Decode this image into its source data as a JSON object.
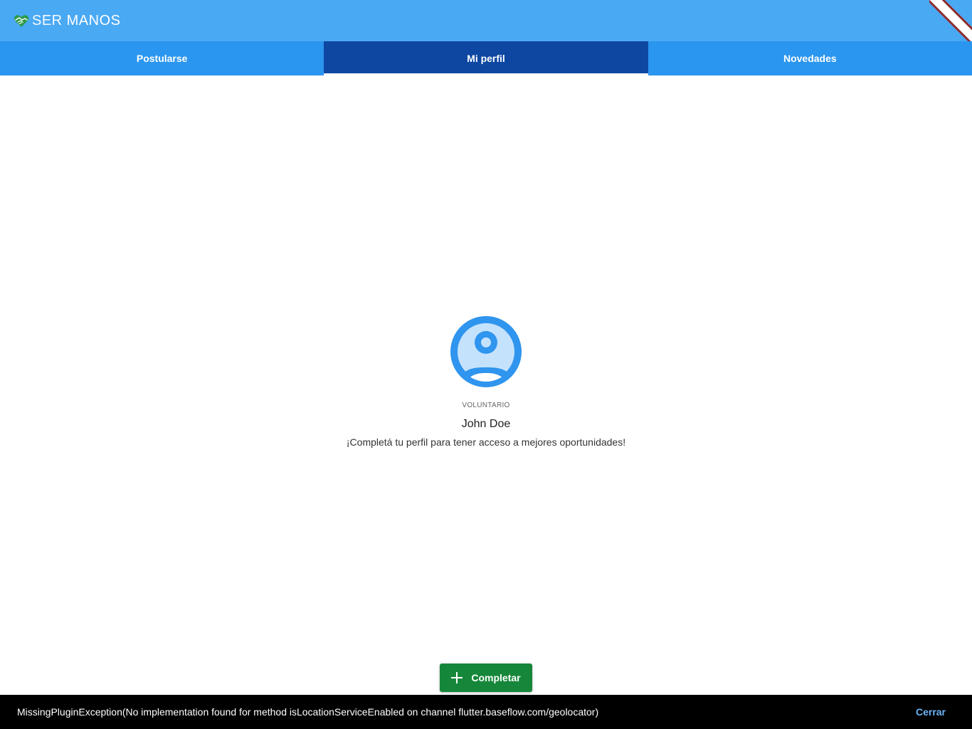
{
  "header": {
    "logo_text_ser": "SER",
    "logo_text_manos": "MANOS",
    "logo_icon": "hands-heart-icon",
    "background_color": "#4aa9f3",
    "debug_banner_colors": [
      "#ffffff",
      "#8b2c2c"
    ]
  },
  "tabs": [
    {
      "label": "Postularse",
      "active": false
    },
    {
      "label": "Mi perfil",
      "active": true
    },
    {
      "label": "Novedades",
      "active": false
    }
  ],
  "tabs_style": {
    "background_color": "#2b96ef",
    "active_color": "#0d47a1",
    "indicator_color": "#ffffff"
  },
  "profile": {
    "avatar_icon": "account-circle-icon",
    "avatar_color": "#2f95ee",
    "avatar_fill": "#c5e2fd",
    "role": "VOLUNTARIO",
    "name": "John Doe",
    "message": "¡Completá tu perfil para tener acceso a mejores oportunidades!"
  },
  "action": {
    "complete_label": "Completar",
    "icon": "plus-icon",
    "color": "#16873a"
  },
  "snackbar": {
    "message": "MissingPluginException(No implementation found for method isLocationServiceEnabled on channel flutter.baseflow.com/geolocator)",
    "action_label": "Cerrar",
    "action_color": "#6cb4f7"
  }
}
